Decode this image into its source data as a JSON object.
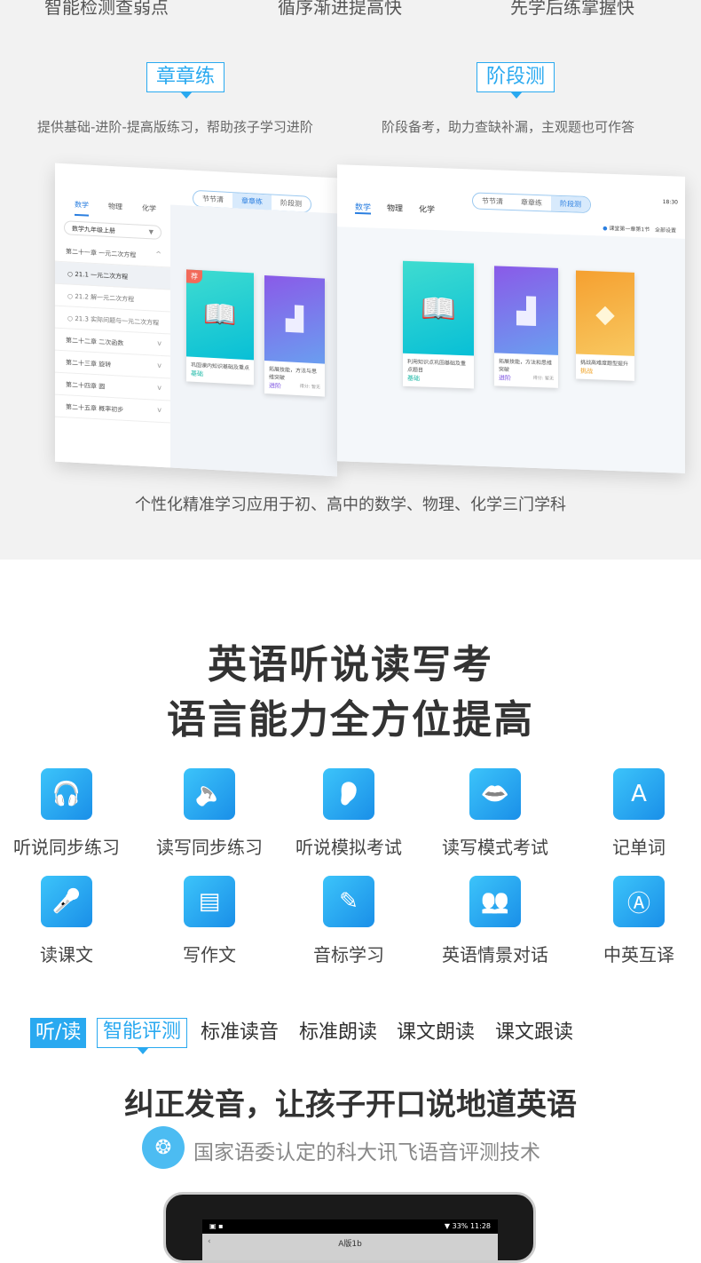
{
  "top_features": [
    "智能检测查弱点",
    "循序渐进提高快",
    "先学后练掌握快"
  ],
  "modes": [
    {
      "title": "章章练",
      "desc": "提供基础-进阶-提高版练习，帮助孩子学习进阶"
    },
    {
      "title": "阶段测",
      "desc": "阶段备考，助力查缺补漏，主观题也可作答"
    }
  ],
  "mockup_left": {
    "segments": [
      "节节清",
      "章章练",
      "阶段测"
    ],
    "subjects": [
      "数学",
      "物理",
      "化学"
    ],
    "book_select": "数学九年级上册",
    "chapters": [
      {
        "label": "第二十一章 一元二次方程",
        "type": "chapter",
        "chev": "^"
      },
      {
        "label": "21.1 一元二次方程",
        "type": "sub",
        "active": true
      },
      {
        "label": "21.2 解一元二次方程",
        "type": "sub"
      },
      {
        "label": "21.3 实际问题与一元二次方程",
        "type": "sub"
      },
      {
        "label": "第二十二章 二次函数",
        "type": "chapter",
        "chev": "v"
      },
      {
        "label": "第二十三章 旋转",
        "type": "chapter",
        "chev": "v"
      },
      {
        "label": "第二十四章 圆",
        "type": "chapter",
        "chev": "v"
      },
      {
        "label": "第二十五章 概率初步",
        "type": "chapter",
        "chev": "v"
      }
    ],
    "badge": "荐",
    "cards": [
      {
        "text": "巩固课内知识基础及重点",
        "level": "基础",
        "color": "#1bb8a6"
      },
      {
        "text": "拓展技能，方法与思维突破",
        "level": "进阶",
        "color": "#7a4fe0",
        "extra": "得分: 暂无"
      }
    ]
  },
  "mockup_right": {
    "segments": [
      "节节清",
      "章章练",
      "阶段测"
    ],
    "subjects": [
      "数学",
      "物理",
      "化学"
    ],
    "status_time": "18:30",
    "location": "课堂第一章第1节",
    "settings": "全部设置",
    "cards": [
      {
        "text": "利用知识点巩固基础及重点题目",
        "level": "基础",
        "color": "#1bb8a6"
      },
      {
        "text": "拓展技能，方法和思维突破",
        "level": "进阶",
        "color": "#7a4fe0",
        "extra": "得分: 暂无"
      },
      {
        "text": "挑战高难度题型提升",
        "level": "挑战",
        "color": "#f0a020"
      }
    ]
  },
  "caption": "个性化精准学习应用于初、高中的数学、物理、化学三门学科",
  "english": {
    "title_line1": "英语听说读写考",
    "title_line2": "语言能力全方位提高",
    "features": [
      {
        "label": "听说同步练习",
        "icon": "headphones-icon"
      },
      {
        "label": "读写同步练习",
        "icon": "speaker-icon"
      },
      {
        "label": "听说模拟考试",
        "icon": "ear-icon"
      },
      {
        "label": "读写模式考试",
        "icon": "lips-icon"
      },
      {
        "label": "记单词",
        "icon": "word-book-icon"
      },
      {
        "label": "读课文",
        "icon": "microphone-icon"
      },
      {
        "label": "写作文",
        "icon": "documents-icon"
      },
      {
        "label": "音标学习",
        "icon": "phonetic-pen-icon"
      },
      {
        "label": "英语情景对话",
        "icon": "people-icon"
      },
      {
        "label": "中英互译",
        "icon": "translate-icon"
      }
    ],
    "tags": {
      "primary": "听/读",
      "selected": "智能评测",
      "others": [
        "标准读音",
        "标准朗读",
        "课文朗读",
        "课文跟读"
      ]
    },
    "headline": "纠正发音，让孩子开口说地道英语",
    "tech": "国家语委认定的科大讯飞语音评测技术",
    "tablet": {
      "battery": "33%",
      "time": "11:28",
      "title": "A版1b"
    }
  },
  "colors": {
    "accent": "#29a9f0",
    "icon_gradient_start": "#3cc4fa",
    "icon_gradient_end": "#1a8fe8",
    "top_bg": "#f2f2f2"
  }
}
